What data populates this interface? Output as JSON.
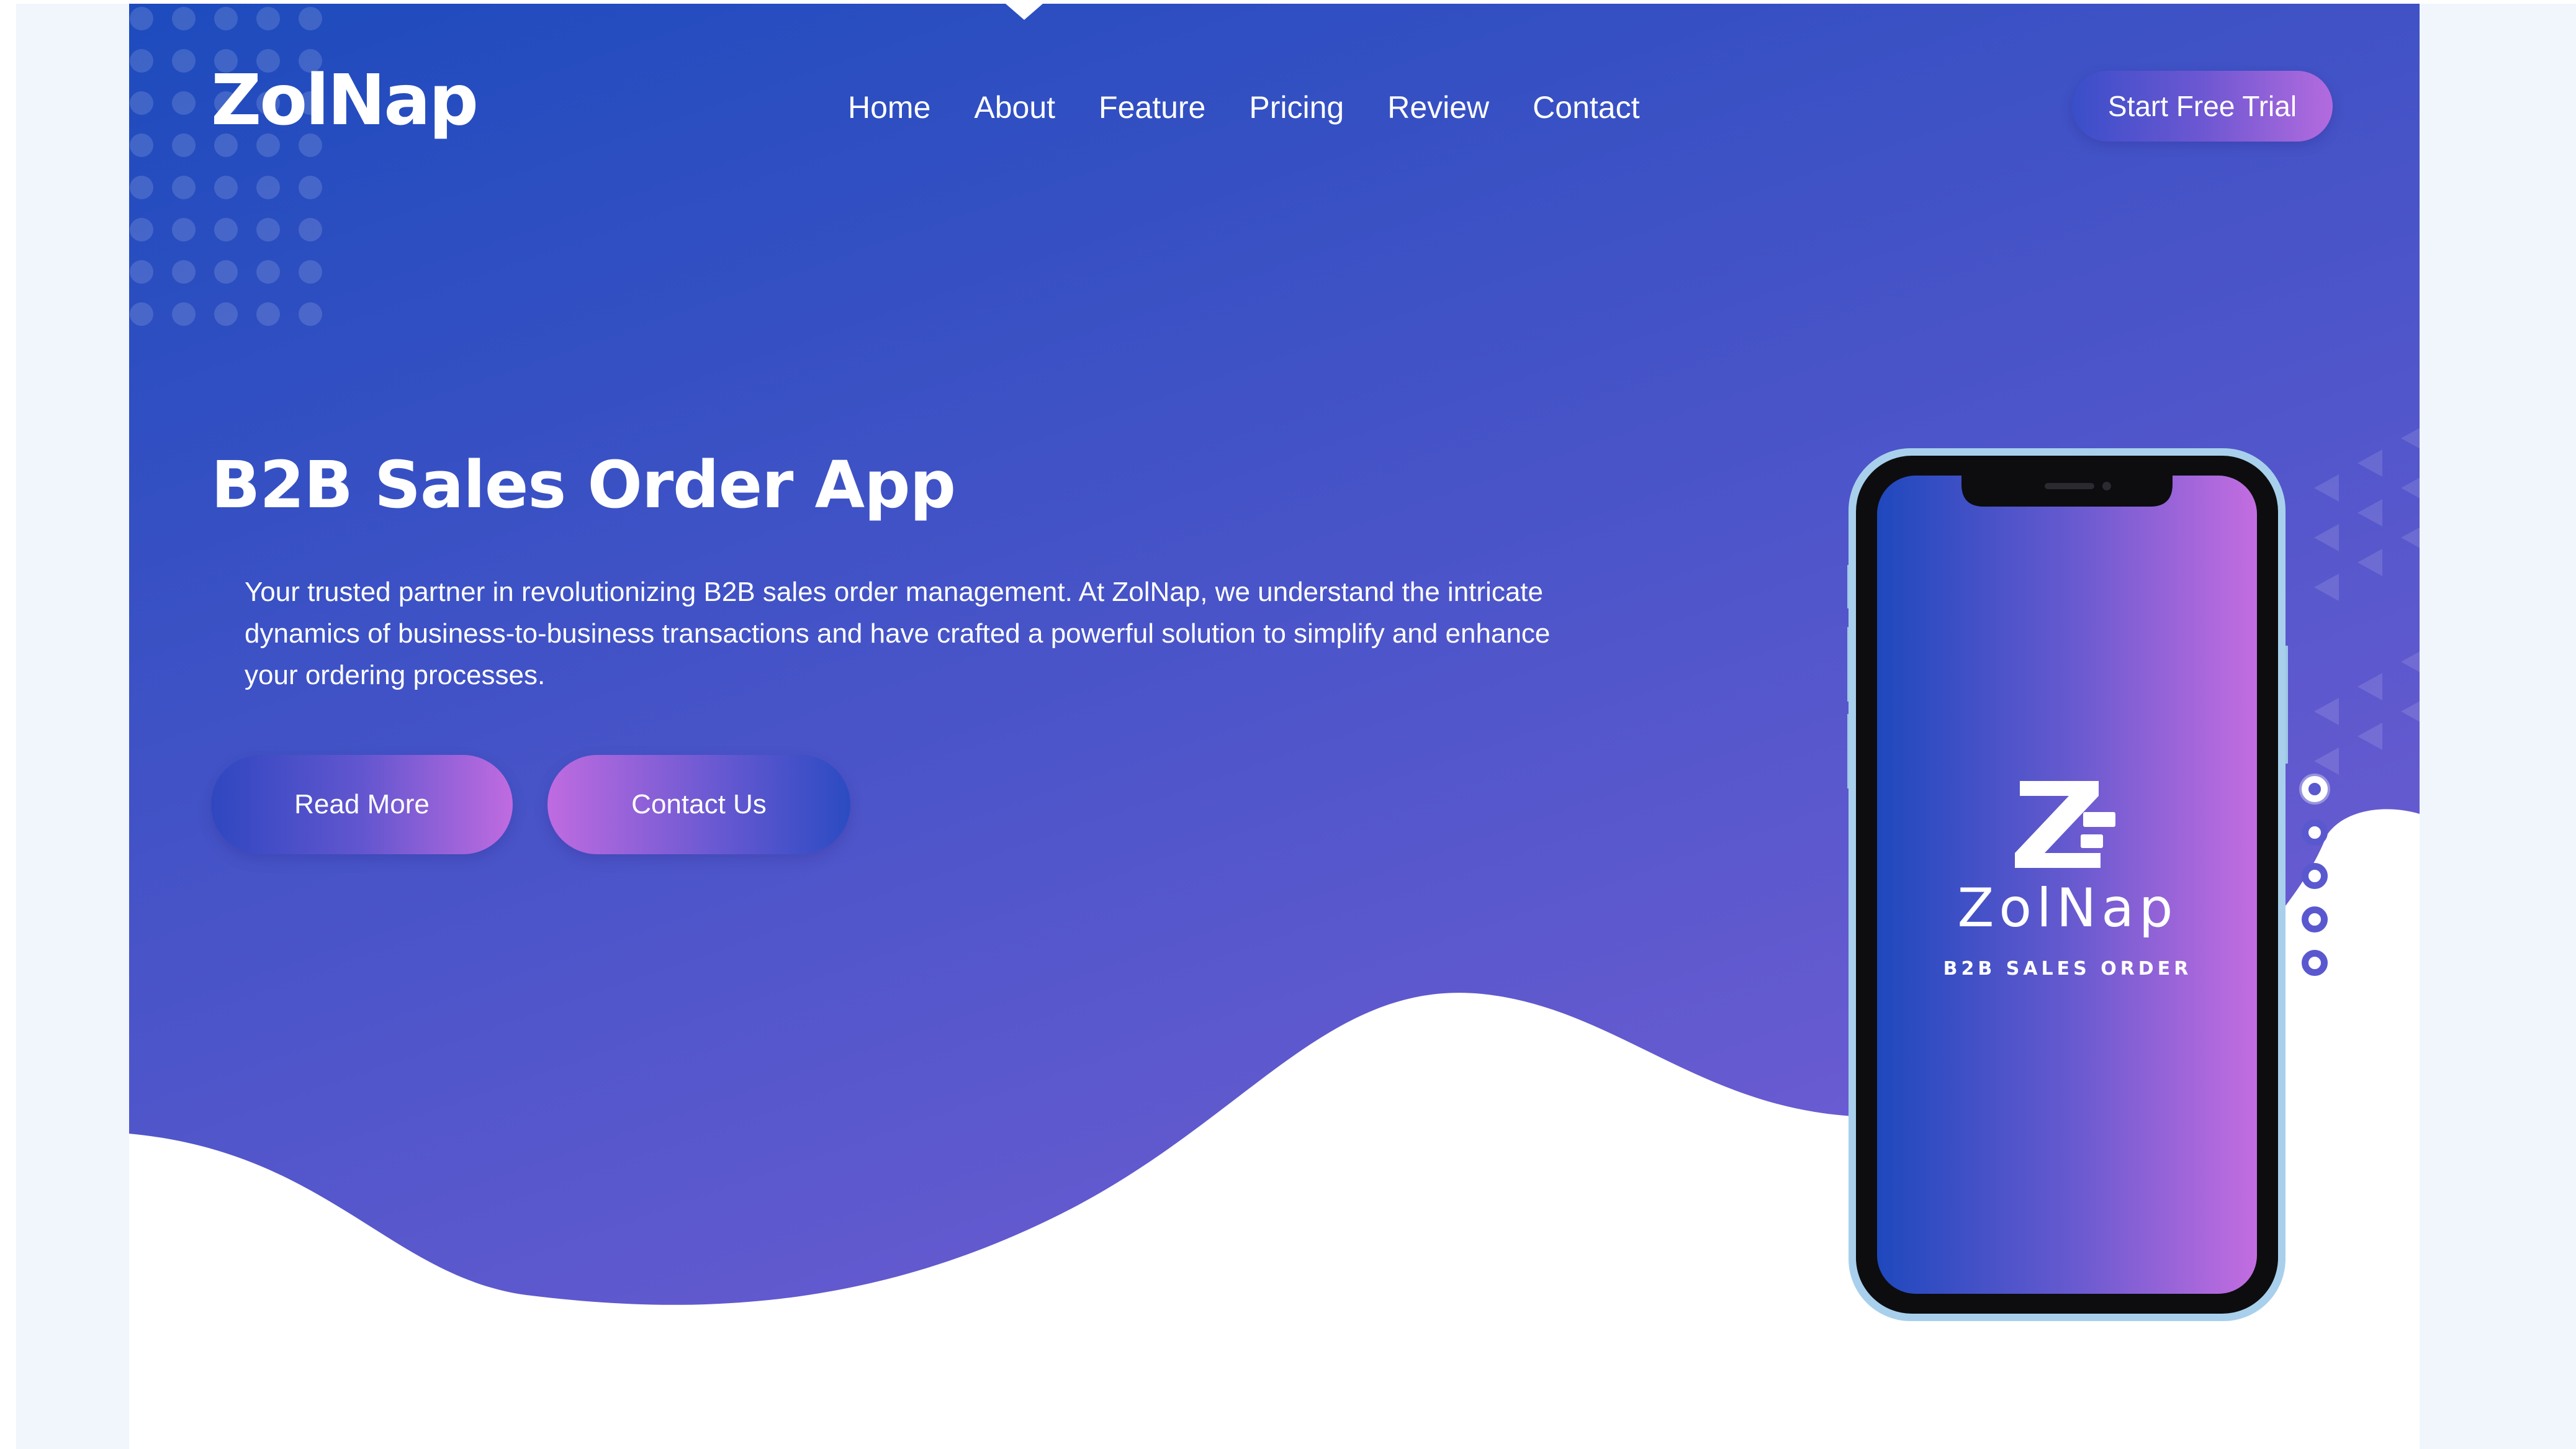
{
  "brand": {
    "logo_text": "ZolNap"
  },
  "nav": {
    "items": [
      "Home",
      "About",
      "Feature",
      "Pricing",
      "Review",
      "Contact"
    ]
  },
  "header": {
    "cta_label": "Start Free Trial"
  },
  "hero": {
    "title": "B2B Sales Order App",
    "description": "Your trusted partner in revolutionizing B2B sales order management. At ZolNap, we understand the intricate dynamics of business-to-business transactions and have crafted a powerful solution to simplify and enhance your ordering processes.",
    "buttons": {
      "read_more": "Read More",
      "contact_us": "Contact Us"
    }
  },
  "phone": {
    "app_name": "ZolNap",
    "app_subtitle": "B2B SALES ORDER"
  },
  "slider": {
    "dot_count": 5,
    "active_index": 0
  },
  "colors": {
    "hero_start": "#1e4bbd",
    "hero_mid": "#6a5bd1",
    "hero_end": "#b56ad9",
    "button_gradient_blue": "#2f47c0",
    "button_gradient_pink": "#c06be0",
    "page_bg": "#ffffff",
    "outer_bg": "#f1f6fd"
  },
  "icons": {
    "logo_mark": "zolnap-z-icon",
    "slider_dot": "slider-dot-icon"
  }
}
